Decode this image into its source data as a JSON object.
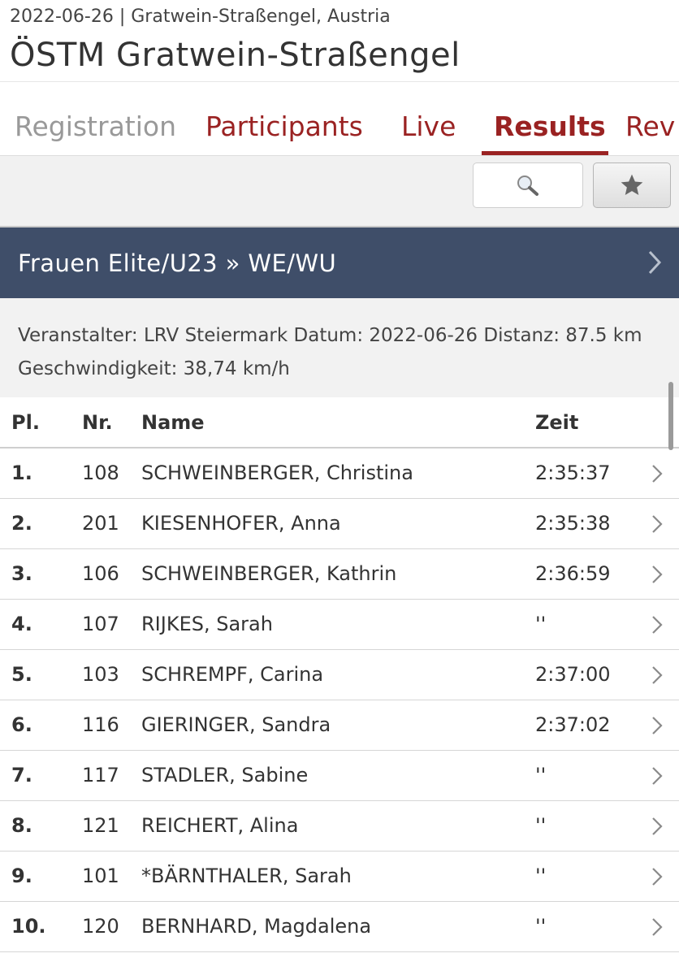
{
  "header": {
    "subtitle": "2022-06-26 | Gratwein-Straßengel, Austria",
    "title": "ÖSTM Gratwein-Straßengel"
  },
  "tabs": [
    {
      "label": "Registration",
      "state": "disabled"
    },
    {
      "label": "Participants",
      "state": "normal"
    },
    {
      "label": "Live",
      "state": "normal"
    },
    {
      "label": "Results",
      "state": "active"
    },
    {
      "label": "Rev",
      "state": "normal"
    }
  ],
  "toolbar": {
    "search_icon": "magnifier-icon",
    "favorite_icon": "star-icon"
  },
  "category": {
    "title": "Frauen Elite/U23 » WE/WU",
    "chevron_icon": "chevron-right-icon"
  },
  "info": {
    "text": "Veranstalter: LRV Steiermark Datum: 2022-06-26 Distanz: 87.5 km Geschwindigkeit: 38,74 km/h"
  },
  "table": {
    "headers": {
      "pl": "Pl.",
      "nr": "Nr.",
      "name": "Name",
      "time": "Zeit"
    },
    "rows": [
      {
        "pl": "1.",
        "nr": "108",
        "name": "SCHWEINBERGER, Christina",
        "time": "2:35:37"
      },
      {
        "pl": "2.",
        "nr": "201",
        "name": "KIESENHOFER, Anna",
        "time": "2:35:38"
      },
      {
        "pl": "3.",
        "nr": "106",
        "name": "SCHWEINBERGER, Kathrin",
        "time": "2:36:59"
      },
      {
        "pl": "4.",
        "nr": "107",
        "name": "RIJKES, Sarah",
        "time": "''"
      },
      {
        "pl": "5.",
        "nr": "103",
        "name": "SCHREMPF, Carina",
        "time": "2:37:00"
      },
      {
        "pl": "6.",
        "nr": "116",
        "name": "GIERINGER, Sandra",
        "time": "2:37:02"
      },
      {
        "pl": "7.",
        "nr": "117",
        "name": "STADLER, Sabine",
        "time": "''"
      },
      {
        "pl": "8.",
        "nr": "121",
        "name": "REICHERT, Alina",
        "time": "''"
      },
      {
        "pl": "9.",
        "nr": "101",
        "name": "*BÄRNTHALER, Sarah",
        "time": "''"
      },
      {
        "pl": "10.",
        "nr": "120",
        "name": "BERNHARD, Magdalena",
        "time": "''"
      }
    ]
  },
  "colors": {
    "accent": "#9a2222",
    "banner": "#3f4e69",
    "disabled_tab": "#999999"
  }
}
